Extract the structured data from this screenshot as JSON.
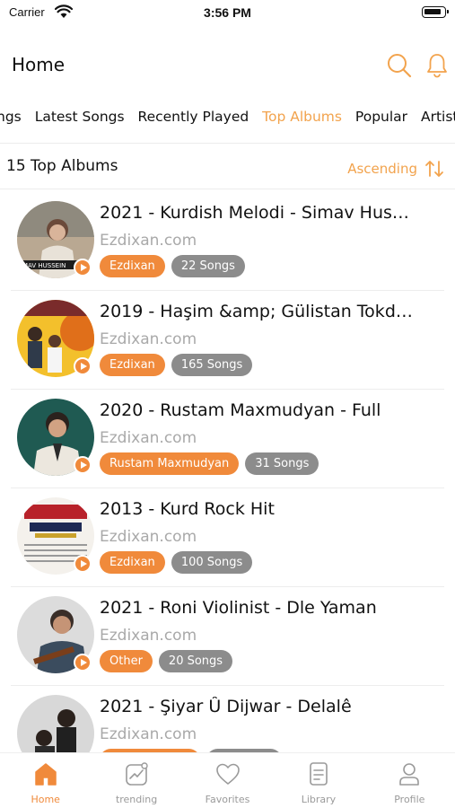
{
  "status_bar": {
    "carrier": "Carrier",
    "time": "3:56 PM"
  },
  "header": {
    "title": "Home"
  },
  "tabs": [
    {
      "label": "ngs",
      "active": false
    },
    {
      "label": "Latest Songs",
      "active": false
    },
    {
      "label": "Recently Played",
      "active": false
    },
    {
      "label": "Top Albums",
      "active": true
    },
    {
      "label": "Popular",
      "active": false
    },
    {
      "label": "Artists",
      "active": false
    }
  ],
  "sort": {
    "count_label": "15 Top Albums",
    "order_label": "Ascending"
  },
  "albums": [
    {
      "title": "2021 - Kurdish Melodi - Simav Hus…",
      "site": "Ezdixan.com",
      "artist": "Ezdixan",
      "songs": "22 Songs"
    },
    {
      "title": "2019 - Haşim &amp; Gülistan Tokd…",
      "site": "Ezdixan.com",
      "artist": "Ezdixan",
      "songs": "165 Songs"
    },
    {
      "title": "2020 - Rustam Maxmudyan - Full",
      "site": "Ezdixan.com",
      "artist": "Rustam Maxmudyan",
      "songs": "31 Songs"
    },
    {
      "title": "2013 - Kurd Rock Hit",
      "site": "Ezdixan.com",
      "artist": "Ezdixan",
      "songs": "100 Songs"
    },
    {
      "title": "2021 - Roni Violinist - Dle Yaman",
      "site": "Ezdixan.com",
      "artist": "Other",
      "songs": "20 Songs"
    },
    {
      "title": "2021 - Şiyar Û Dijwar - Delalê",
      "site": "Ezdixan.com",
      "artist": "",
      "songs": ""
    }
  ],
  "bottom_nav": [
    {
      "label": "Home",
      "icon": "home-icon",
      "active": true
    },
    {
      "label": "trending",
      "icon": "trending-icon",
      "active": false
    },
    {
      "label": "Favorites",
      "icon": "heart-icon",
      "active": false
    },
    {
      "label": "Library",
      "icon": "library-icon",
      "active": false
    },
    {
      "label": "Profile",
      "icon": "profile-icon",
      "active": false
    }
  ],
  "colors": {
    "accent": "#f2a34d",
    "badge_orange": "#f08a3b",
    "badge_gray": "#8c8c8c",
    "muted_text": "#a9a9a9"
  }
}
